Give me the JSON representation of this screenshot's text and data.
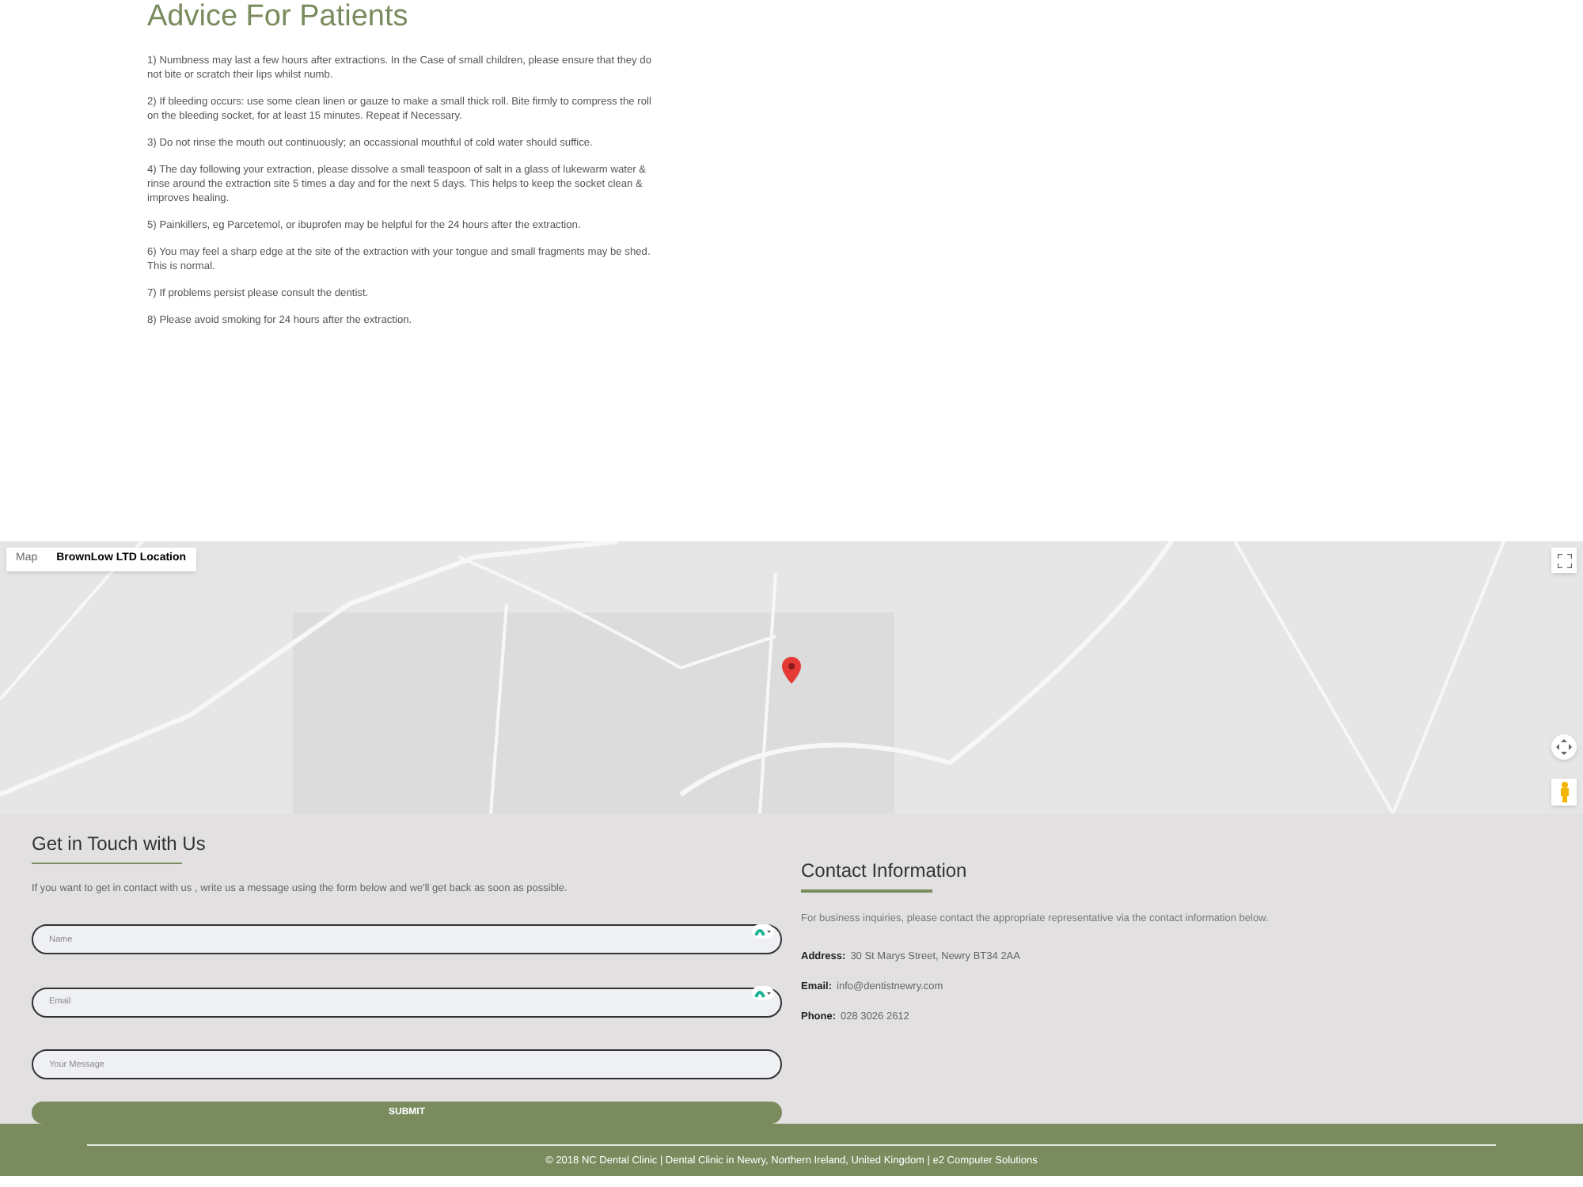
{
  "advice": {
    "title": "Advice For Patients",
    "items": [
      "1) Numbness may last a few hours after extractions. In the Case of small children, please ensure that they do not bite or scratch their lips whilst numb.",
      "2) If bleeding occurs: use some clean linen or gauze to make a small thick roll. Bite firmly to compress the roll on the bleeding socket, for at least 15 minutes. Repeat if Necessary.",
      "3) Do not rinse the mouth out continuously; an occassional mouthful of cold water should suffice.",
      "4) The day following your extraction, please dissolve a small teaspoon of salt in a glass of lukewarm water & rinse around the extraction site 5 times a day and for the next 5 days. This helps to keep the socket clean & improves healing.",
      "5) Painkillers, eg Parcetemol, or ibuprofen may be helpful for the 24 hours after the extraction.",
      "6) You may feel a sharp edge at the site of the extraction with your tongue and small fragments may be shed. This is normal.",
      "7) If problems persist please consult the dentist.",
      "8) Please avoid smoking for 24 hours after the extraction."
    ]
  },
  "map": {
    "tabs": [
      {
        "label": "Map",
        "selected": false
      },
      {
        "label": "BrownLow LTD Location",
        "selected": true
      }
    ]
  },
  "contact_form": {
    "title": "Get in Touch with Us",
    "intro": "If you want to get in contact with us , write us a message using the form below and we'll get back as soon as possible.",
    "fields": [
      {
        "placeholder": "Name",
        "autofill_icon": true
      },
      {
        "placeholder": "Email",
        "autofill_icon": true
      },
      {
        "placeholder": "Your Message",
        "autofill_icon": false
      }
    ],
    "submit": "SUBMIT"
  },
  "contact_info": {
    "title": "Contact Information",
    "intro": "For business inquiries, please contact the appropriate representative via the contact information below.",
    "lines": [
      {
        "label": "Address:",
        "value": "30 St Marys Street, Newry BT34 2AA"
      },
      {
        "label": "Email:",
        "value": "info@dentistnewry.com"
      },
      {
        "label": "Phone:",
        "value": "028 3026 2612"
      }
    ]
  },
  "footer": {
    "text": "© 2018 NC Dental Clinic | Dental Clinic in Newry, Northern Ireland, United Kingdom | e2 Computer Solutions"
  }
}
